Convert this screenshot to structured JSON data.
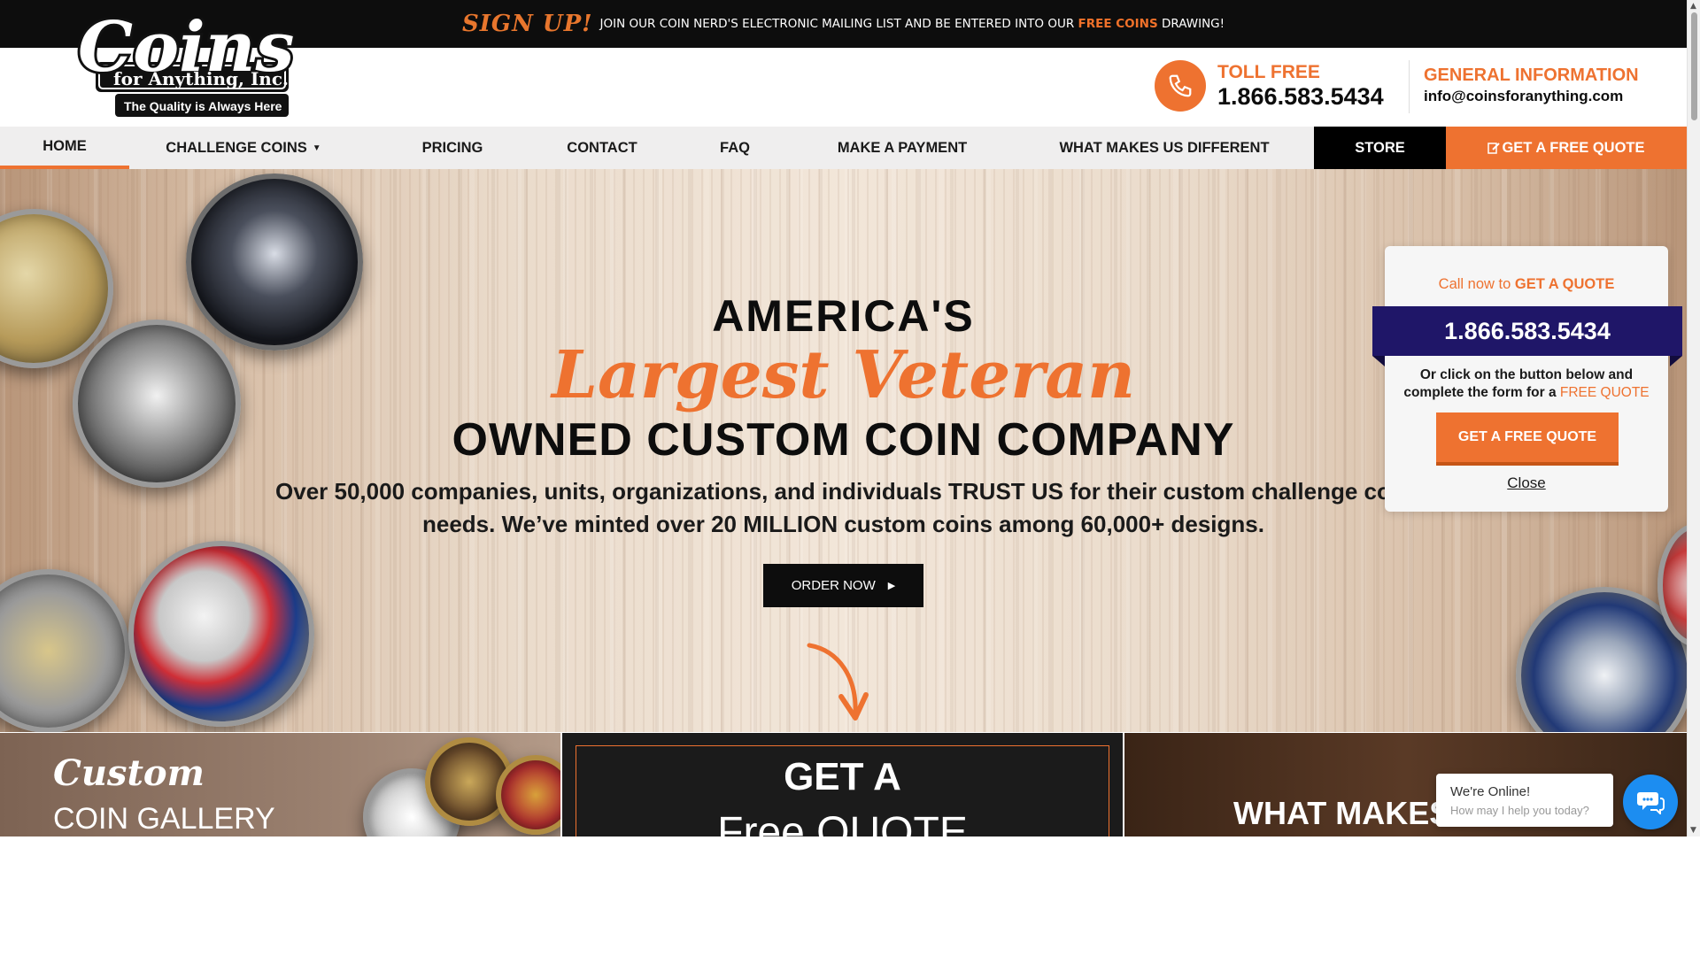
{
  "topbar": {
    "signup": "SIGN UP!",
    "message_pre": "JOIN OUR COIN NERD'S ELECTRONIC MAILING LIST AND BE ENTERED INTO OUR ",
    "message_highlight": "FREE COINS",
    "message_post": " DRAWING!"
  },
  "logo": {
    "line1": "Coins",
    "line2": "for Anything, Inc.",
    "tagline": "The Quality is Always Here"
  },
  "header": {
    "toll_label": "TOLL FREE",
    "toll_number": "1.866.583.5434",
    "info_label": "GENERAL INFORMATION",
    "info_email": "info@coinsforanything.com"
  },
  "nav": [
    {
      "label": "HOME",
      "active": true
    },
    {
      "label": "CHALLENGE COINS",
      "caret": "▼"
    },
    {
      "label": "PRICING"
    },
    {
      "label": "CONTACT"
    },
    {
      "label": "FAQ"
    },
    {
      "label": "MAKE A PAYMENT"
    },
    {
      "label": "WHAT MAKES US DIFFERENT"
    },
    {
      "label": "STORE"
    },
    {
      "label": "GET A FREE QUOTE"
    }
  ],
  "hero": {
    "line1": "AMERICA'S",
    "script": "Largest Veteran",
    "line3": "OWNED CUSTOM COIN COMPANY",
    "description": "Over 50,000 companies, units, organizations, and individuals TRUST US for their custom challenge coin needs. We’ve minted over 20 MILLION custom coins among 60,000+ designs.",
    "order_button": "ORDER NOW"
  },
  "panels": {
    "gallery_script": "Custom",
    "gallery_title": "COIN GALLERY",
    "quote_title": "GET A",
    "quote_sub": "Free QUOTE",
    "different_title": "WHAT MAKES US"
  },
  "popup": {
    "call_pre": "Call now to ",
    "call_bold": "GET A QUOTE",
    "phone": "1.866.583.5434",
    "text_pre": "Or click on the button below and complete the form for a ",
    "text_highlight": "FREE QUOTE",
    "button": "GET A FREE QUOTE",
    "close": "Close"
  },
  "chat": {
    "online": "We're Online!",
    "help": "How may I help you today?"
  },
  "colors": {
    "accent": "#ee7230",
    "dark": "#0d0d0d",
    "popup_phone_bg": "#1f1668",
    "chat_blue": "#1c8df1"
  }
}
